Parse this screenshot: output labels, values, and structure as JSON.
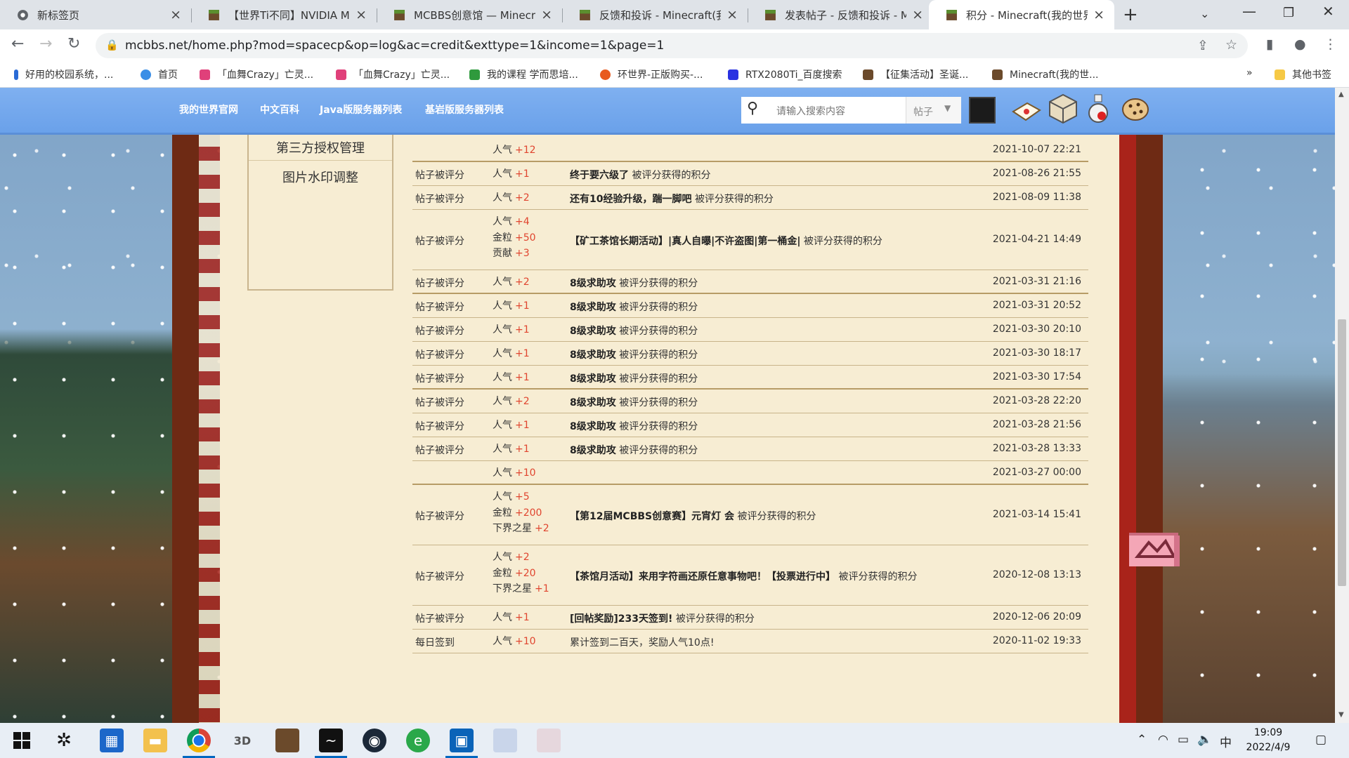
{
  "tabs": [
    {
      "title": "新标签页",
      "icon": "chrome-icon",
      "active": false
    },
    {
      "title": "【世界Ti不同】NVIDIA Mc",
      "icon": "minecraft-block-icon",
      "active": false
    },
    {
      "title": "MCBBS创意馆 — Minecra",
      "icon": "minecraft-block-icon",
      "active": false
    },
    {
      "title": "反馈和投诉 - Minecraft(我",
      "icon": "minecraft-block-icon",
      "active": false
    },
    {
      "title": "发表帖子 - 反馈和投诉 - M",
      "icon": "minecraft-block-icon",
      "active": false
    },
    {
      "title": "积分 - Minecraft(我的世界",
      "icon": "minecraft-block-icon",
      "active": true
    }
  ],
  "address_bar": {
    "url": "mcbbs.net/home.php?mod=spacecp&op=log&ac=credit&exttype=1&income=1&page=1"
  },
  "bookmarks": [
    {
      "label": "好用的校园系统，...",
      "color": "#2a6bd6"
    },
    {
      "label": "首页",
      "color": "#3a8ee6"
    },
    {
      "label": "「血舞Crazy」亡灵...",
      "color": "#e0407a"
    },
    {
      "label": "「血舞Crazy」亡灵...",
      "color": "#e0407a"
    },
    {
      "label": "我的课程 学而思培...",
      "color": "#2f9a3d"
    },
    {
      "label": "环世界-正版购买-...",
      "color": "#e85a1e"
    },
    {
      "label": "RTX2080Ti_百度搜索",
      "color": "#2932e1"
    },
    {
      "label": "【征集活动】圣诞...",
      "color": "#6b4a2b"
    },
    {
      "label": "Minecraft(我的世...",
      "color": "#6b4a2b"
    }
  ],
  "other_bookmarks": "其他书签",
  "site_nav": {
    "links": [
      "我的世界官网",
      "中文百科",
      "Java版服务器列表",
      "基岩版服务器列表"
    ],
    "search_placeholder": "请输入搜索内容",
    "search_type": "帖子"
  },
  "side_menu": [
    "第三方授权管理",
    "图片水印调整"
  ],
  "credit_log": [
    {
      "type": "",
      "changes": [
        {
          "k": "人气",
          "v": "+12"
        }
      ],
      "title": "",
      "suffix": "",
      "time": "2021-10-07 22:21",
      "thick": true
    },
    {
      "type": "帖子被评分",
      "changes": [
        {
          "k": "人气",
          "v": "+1"
        }
      ],
      "title": "终于要六级了",
      "suffix": "被评分获得的积分",
      "time": "2021-08-26 21:55"
    },
    {
      "type": "帖子被评分",
      "changes": [
        {
          "k": "人气",
          "v": "+2"
        }
      ],
      "title": "还有10经验升级，踹一脚吧",
      "suffix": "被评分获得的积分",
      "time": "2021-08-09 11:38"
    },
    {
      "type": "帖子被评分",
      "changes": [
        {
          "k": "人气",
          "v": "+4"
        },
        {
          "k": "金粒",
          "v": "+50"
        },
        {
          "k": "贡献",
          "v": "+3"
        }
      ],
      "title": "【矿工茶馆长期活动】|真人自曝|不许盗图|第一桶金|",
      "suffix": "被评分获得的积分",
      "time": "2021-04-21 14:49"
    },
    {
      "type": "帖子被评分",
      "changes": [
        {
          "k": "人气",
          "v": "+2"
        }
      ],
      "title": "8级求助攻",
      "suffix": "被评分获得的积分",
      "time": "2021-03-31 21:16",
      "thick": true
    },
    {
      "type": "帖子被评分",
      "changes": [
        {
          "k": "人气",
          "v": "+1"
        }
      ],
      "title": "8级求助攻",
      "suffix": "被评分获得的积分",
      "time": "2021-03-31 20:52"
    },
    {
      "type": "帖子被评分",
      "changes": [
        {
          "k": "人气",
          "v": "+1"
        }
      ],
      "title": "8级求助攻",
      "suffix": "被评分获得的积分",
      "time": "2021-03-30 20:10"
    },
    {
      "type": "帖子被评分",
      "changes": [
        {
          "k": "人气",
          "v": "+1"
        }
      ],
      "title": "8级求助攻",
      "suffix": "被评分获得的积分",
      "time": "2021-03-30 18:17"
    },
    {
      "type": "帖子被评分",
      "changes": [
        {
          "k": "人气",
          "v": "+1"
        }
      ],
      "title": "8级求助攻",
      "suffix": "被评分获得的积分",
      "time": "2021-03-30 17:54",
      "thick": true
    },
    {
      "type": "帖子被评分",
      "changes": [
        {
          "k": "人气",
          "v": "+2"
        }
      ],
      "title": "8级求助攻",
      "suffix": "被评分获得的积分",
      "time": "2021-03-28 22:20"
    },
    {
      "type": "帖子被评分",
      "changes": [
        {
          "k": "人气",
          "v": "+1"
        }
      ],
      "title": "8级求助攻",
      "suffix": "被评分获得的积分",
      "time": "2021-03-28 21:56"
    },
    {
      "type": "帖子被评分",
      "changes": [
        {
          "k": "人气",
          "v": "+1"
        }
      ],
      "title": "8级求助攻",
      "suffix": "被评分获得的积分",
      "time": "2021-03-28 13:33"
    },
    {
      "type": "",
      "changes": [
        {
          "k": "人气",
          "v": "+10"
        }
      ],
      "title": "",
      "suffix": "",
      "time": "2021-03-27 00:00",
      "thick": true
    },
    {
      "type": "帖子被评分",
      "changes": [
        {
          "k": "人气",
          "v": "+5"
        },
        {
          "k": "金粒",
          "v": "+200"
        },
        {
          "k": "下界之星",
          "v": "+2"
        }
      ],
      "title": "【第12届MCBBS创意赛】元宵灯 会",
      "suffix": "被评分获得的积分",
      "time": "2021-03-14 15:41"
    },
    {
      "type": "帖子被评分",
      "changes": [
        {
          "k": "人气",
          "v": "+2"
        },
        {
          "k": "金粒",
          "v": "+20"
        },
        {
          "k": "下界之星",
          "v": "+1"
        }
      ],
      "title": "【茶馆月活动】来用字符画还原任意事物吧！【投票进行中】",
      "suffix": "被评分获得的积分",
      "time": "2020-12-08 13:13"
    },
    {
      "type": "帖子被评分",
      "changes": [
        {
          "k": "人气",
          "v": "+1"
        }
      ],
      "title": "[回帖奖励]233天签到!",
      "suffix": "被评分获得的积分",
      "time": "2020-12-06 20:09"
    },
    {
      "type": "每日签到",
      "changes": [
        {
          "k": "人气",
          "v": "+10"
        }
      ],
      "title": "",
      "suffix": "累计签到二百天，奖励人气10点!",
      "time": "2020-11-02 19:33"
    }
  ],
  "taskbar": {
    "time": "19:09",
    "date": "2022/4/9",
    "ime": "中",
    "apps": [
      "windows-start-icon",
      "app-icon",
      "store-icon",
      "file-explorer-icon",
      "chrome-icon",
      "3d-viewer-icon",
      "minecraft-icon",
      "app-icon",
      "steam-icon",
      "edge-icon",
      "app-icon",
      "anime-avatar-icon",
      "anime-avatar-icon"
    ]
  },
  "colors": {
    "value_red": "#e0452f",
    "nav_blue": "#6aa1ea",
    "parchment": "#f7edd3",
    "frame_brown": "#6e2a14"
  }
}
